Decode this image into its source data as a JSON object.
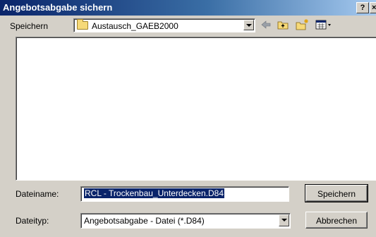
{
  "window": {
    "title": "Angebotsabgabe sichern",
    "help_label": "?",
    "close_label": "×"
  },
  "toolbar": {
    "save_in_label": "Speichern",
    "folder_value": "Austausch_GAEB2000",
    "icons": [
      "back-icon",
      "up-folder-icon",
      "new-folder-icon",
      "view-menu-icon"
    ]
  },
  "form": {
    "filename_label": "Dateiname:",
    "filename_value": "RCL - Trockenbau_Unterdecken.D84",
    "filetype_label": "Dateityp:",
    "filetype_value": "Angebotsabgabe - Datei (*.D84)",
    "save_button": "Speichern",
    "cancel_button": "Abbrechen"
  },
  "colors": {
    "title_active": "#0a246a",
    "face": "#d4d0c8",
    "selection": "#0a246a"
  }
}
